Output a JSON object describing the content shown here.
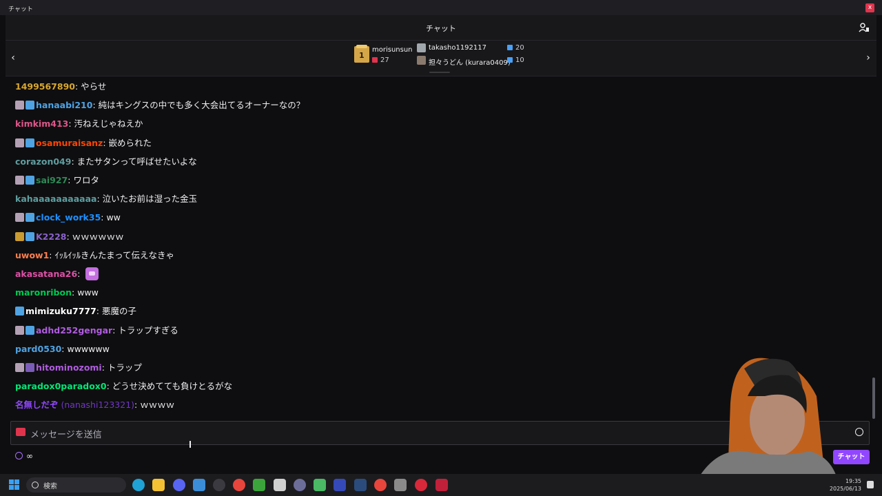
{
  "window": {
    "title": "チャット",
    "close_label": "x"
  },
  "header": {
    "title": "チャット"
  },
  "leaderboard": {
    "first": {
      "rank_label": "1",
      "name": "morisunsun",
      "count": "27"
    },
    "ranks": [
      {
        "name": "takasho1192117",
        "count": "20"
      },
      {
        "name": "担々うどん (kurara0409)",
        "count": "10"
      }
    ]
  },
  "messages": [
    {
      "user": "1499567890",
      "color": "#d9a72e",
      "badges": [],
      "text": "やらせ"
    },
    {
      "user": "hanaabi210",
      "color": "#4fa3e3",
      "badges": [
        "sub",
        "crown"
      ],
      "text": "純はキングスの中でも多く大会出てるオーナーなの？"
    },
    {
      "user": "kimkim413",
      "color": "#e0568a",
      "badges": [],
      "text": "汚ねえじゃねえか"
    },
    {
      "user": "osamuraisanz",
      "color": "#ff4500",
      "badges": [
        "sub",
        "crown"
      ],
      "text": "嵌められた"
    },
    {
      "user": "corazon049",
      "color": "#5f9ea0",
      "badges": [],
      "text": "またサタンって呼ばせたいよな"
    },
    {
      "user": "sai927",
      "color": "#2e8b57",
      "badges": [
        "sub",
        "crown"
      ],
      "text": "ワロタ"
    },
    {
      "user": "kahaaaaaaaaaaa",
      "color": "#5f9ea0",
      "badges": [],
      "text": "泣いたお前は湿った金玉"
    },
    {
      "user": "clock_work35",
      "color": "#1e90ff",
      "badges": [
        "sub",
        "crown"
      ],
      "text": "ww"
    },
    {
      "user": "K2228",
      "color": "#8a63c9",
      "badges": [
        "gold",
        "crown"
      ],
      "text": "ｗｗｗｗｗｗ"
    },
    {
      "user": "uwow1",
      "color": "#ff7f50",
      "badges": [],
      "text": "ｲｯﾙｲｯﾙきんたまって伝えなきゃ"
    },
    {
      "user": "akasatana26",
      "color": "#e04fa8",
      "badges": [],
      "text": "",
      "emote": "emote-icon"
    },
    {
      "user": "maronribon",
      "color": "#00c853",
      "badges": [],
      "text": "www"
    },
    {
      "user": "mimizuku7777",
      "color": "#ffffff",
      "badges": [
        "crown"
      ],
      "text": "悪魔の子"
    },
    {
      "user": "adhd252gengar",
      "color": "#b05ce0",
      "badges": [
        "sub",
        "crown"
      ],
      "text": "トラップすぎる"
    },
    {
      "user": "pard0530",
      "color": "#4fa3e3",
      "badges": [],
      "text": "wwwwww"
    },
    {
      "user": "hitominozomi",
      "color": "#b05ce0",
      "badges": [
        "sub",
        "purple"
      ],
      "text": "トラップ"
    },
    {
      "user": "paradox0paradox0",
      "color": "#00e676",
      "badges": [],
      "text": "どうせ決めてても負けとるがな"
    },
    {
      "user": "名無しだぞ",
      "alt": "(nanashi123321)",
      "color": "#9147ff",
      "badges": [],
      "text": "ｗｗｗｗ"
    }
  ],
  "input": {
    "placeholder": "メッセージを送信"
  },
  "footer": {
    "timer_value": "∞",
    "chat_button": "チャット"
  },
  "taskbar": {
    "search_label": "検索",
    "time": "19:35",
    "date": "2025/06/13"
  }
}
